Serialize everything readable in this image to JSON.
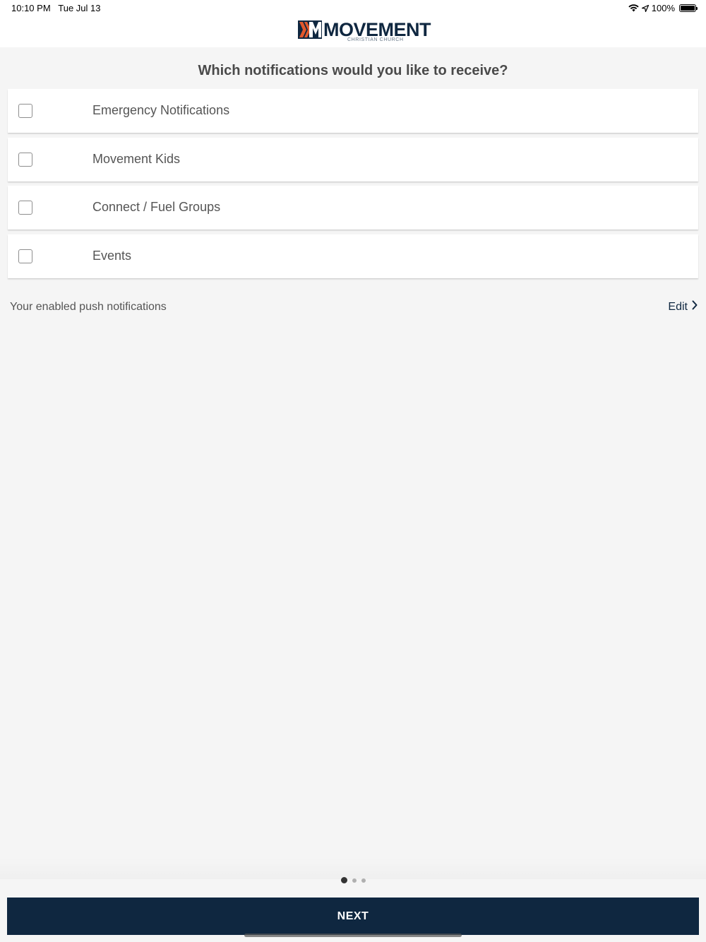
{
  "status_bar": {
    "time": "10:10 PM",
    "date": "Tue Jul 13",
    "battery": "100%",
    "icons": [
      "wifi-icon",
      "location-icon",
      "battery-icon"
    ]
  },
  "header": {
    "logo_text": "MOVEMENT",
    "logo_subtext": "CHRISTIAN CHURCH"
  },
  "question": "Which notifications would you like to receive?",
  "options": [
    {
      "label": "Emergency Notifications",
      "checked": false
    },
    {
      "label": "Movement Kids",
      "checked": false
    },
    {
      "label": "Connect / Fuel Groups",
      "checked": false
    },
    {
      "label": "Events",
      "checked": false
    }
  ],
  "enabled_section": {
    "text": "Your enabled push notifications",
    "edit_label": "Edit",
    "edit_icon": "chevron-right-icon"
  },
  "pager": {
    "current": 1,
    "total": 3
  },
  "next_button": {
    "label": "NEXT"
  },
  "colors": {
    "brand": "#0f2740",
    "accent": "#e2582c",
    "background": "#f5f5f5"
  }
}
